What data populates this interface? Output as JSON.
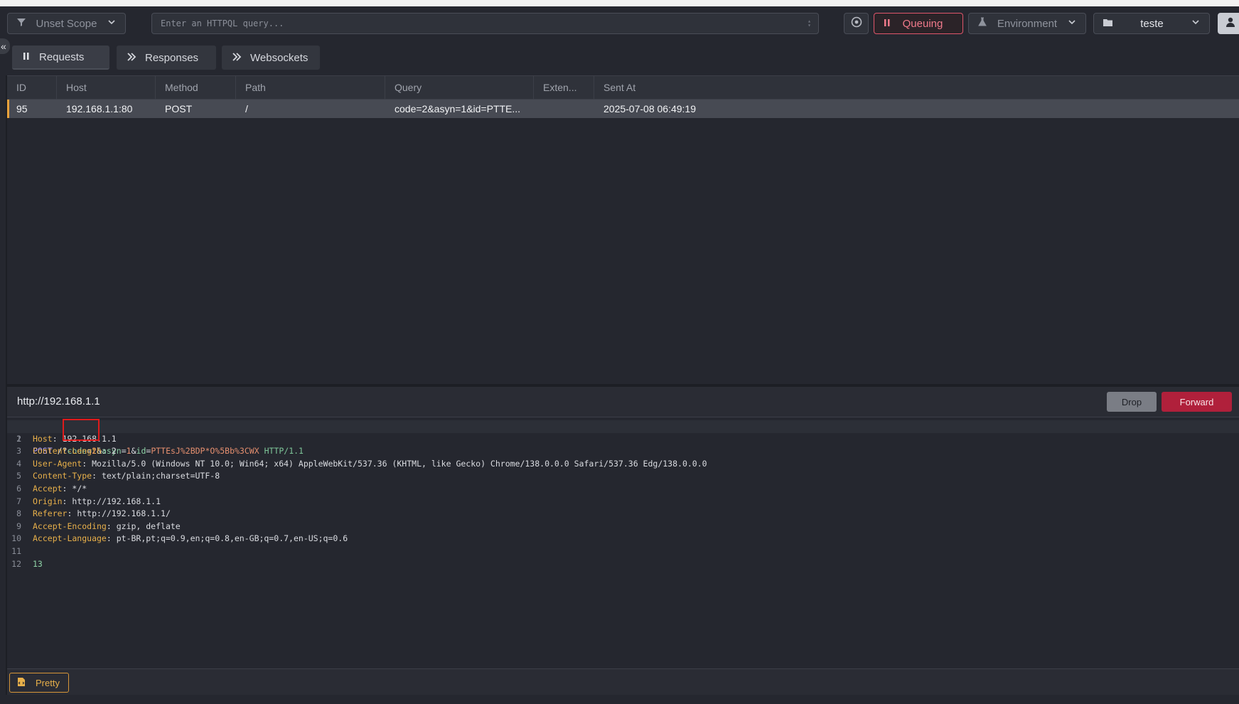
{
  "toolbar": {
    "scope_label": "Unset Scope",
    "query_placeholder": "Enter an HTTPQL query...",
    "queuing_label": "Queuing",
    "environment_label": "Environment",
    "project_label": "teste"
  },
  "tabs": [
    {
      "label": "Requests"
    },
    {
      "label": "Responses"
    },
    {
      "label": "Websockets"
    }
  ],
  "table": {
    "columns": [
      "ID",
      "Host",
      "Method",
      "Path",
      "Query",
      "Exten...",
      "Sent At"
    ],
    "rows": [
      {
        "id": "95",
        "host": "192.168.1.1:80",
        "method": "POST",
        "path": "/",
        "query": "code=2&asyn=1&id=PTTE...",
        "ext": "",
        "sent_at": "2025-07-08 06:49:19"
      }
    ]
  },
  "request": {
    "url": "http://192.168.1.1",
    "drop_label": "Drop",
    "forward_label": "Forward",
    "line1": {
      "method": "POST",
      "path": " /?",
      "q1k": "code",
      "q1v": "2",
      "q2k": "asyn",
      "q2v": "1",
      "q3k": "id",
      "q3v": "PTTEsJ%2BDP*O%5Bb%3CWX",
      "proto": "HTTP/1.1"
    },
    "headers": [
      {
        "key": "Host",
        "value": "192.168.1.1"
      },
      {
        "key": "Content-Length",
        "value": "2"
      },
      {
        "key": "User-Agent",
        "value": "Mozilla/5.0 (Windows NT 10.0; Win64; x64) AppleWebKit/537.36 (KHTML, like Gecko) Chrome/138.0.0.0 Safari/537.36 Edg/138.0.0.0"
      },
      {
        "key": "Content-Type",
        "value": "text/plain;charset=UTF-8"
      },
      {
        "key": "Accept",
        "value": "*/*"
      },
      {
        "key": "Origin",
        "value": "http://192.168.1.1"
      },
      {
        "key": "Referer",
        "value": "http://192.168.1.1/"
      },
      {
        "key": "Accept-Encoding",
        "value": "gzip, deflate"
      },
      {
        "key": "Accept-Language",
        "value": "pt-BR,pt;q=0.9,en;q=0.8,en-GB;q=0.7,en-US;q=0.6"
      }
    ],
    "body": "13",
    "line_numbers": [
      "1",
      "2",
      "3",
      "4",
      "5",
      "6",
      "7",
      "8",
      "9",
      "10",
      "11",
      "12"
    ]
  },
  "footer": {
    "pretty_label": "Pretty"
  }
}
